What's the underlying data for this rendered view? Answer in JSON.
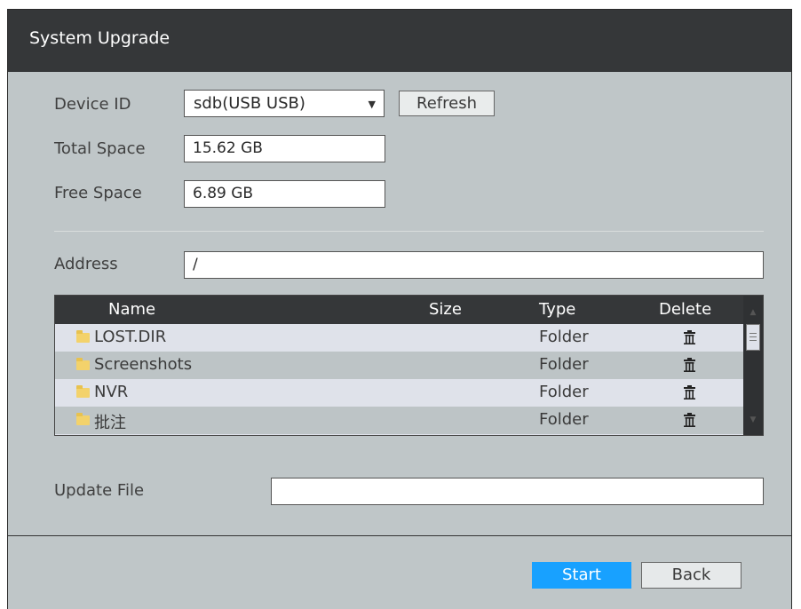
{
  "window": {
    "title": "System Upgrade"
  },
  "device": {
    "device_id_label": "Device ID",
    "device_id_value": "sdb(USB USB)",
    "refresh_label": "Refresh",
    "total_space_label": "Total Space",
    "total_space_value": "15.62 GB",
    "free_space_label": "Free Space",
    "free_space_value": "6.89 GB"
  },
  "address": {
    "label": "Address",
    "value": "/"
  },
  "table": {
    "columns": [
      "Name",
      "Size",
      "Type",
      "Delete"
    ],
    "rows": [
      {
        "name": "LOST.DIR",
        "size": "",
        "type": "Folder",
        "icon": "folder-icon"
      },
      {
        "name": "Screenshots",
        "size": "",
        "type": "Folder",
        "icon": "folder-icon"
      },
      {
        "name": "NVR",
        "size": "",
        "type": "Folder",
        "icon": "folder-icon"
      },
      {
        "name": "批注",
        "size": "",
        "type": "Folder",
        "icon": "folder-icon"
      }
    ]
  },
  "update_file": {
    "label": "Update File",
    "value": ""
  },
  "footer": {
    "start_label": "Start",
    "back_label": "Back"
  },
  "colors": {
    "titlebar": "#353739",
    "panel": "#bfc6c8",
    "accent": "#18a1ff",
    "row_alt": "#bdc4c6",
    "row_norm": "#dfe2ea"
  }
}
